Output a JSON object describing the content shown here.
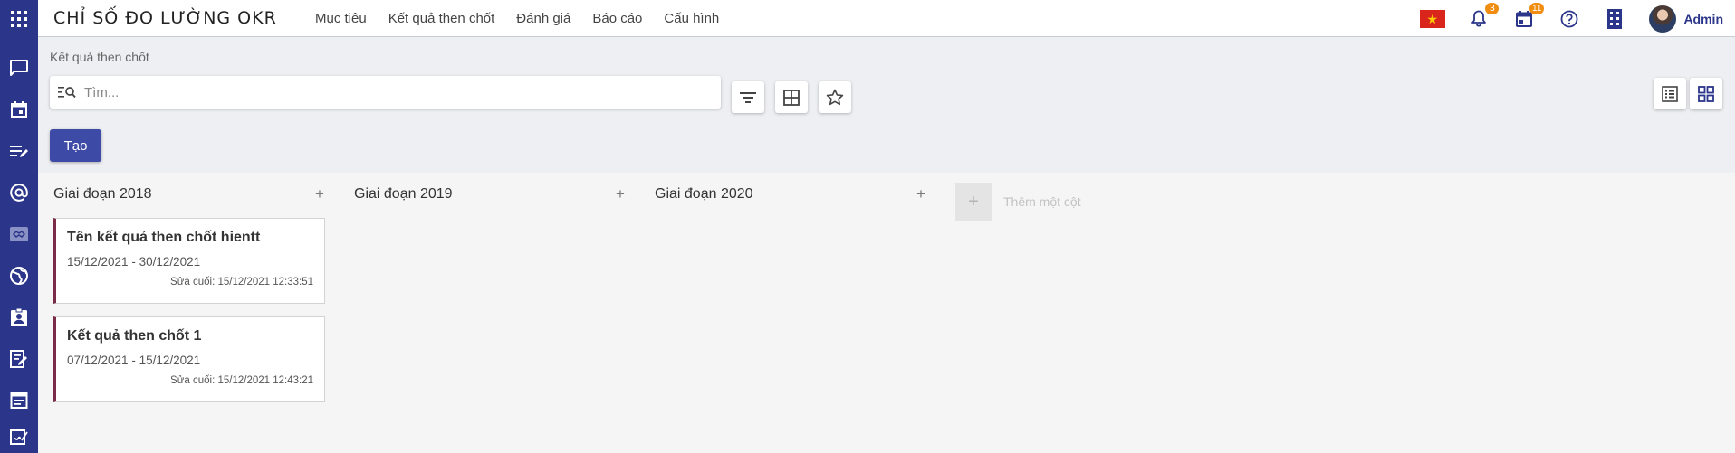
{
  "header": {
    "app_title": "CHỈ SỐ ĐO LƯỜNG OKR",
    "menu": [
      {
        "label": "Mục tiêu"
      },
      {
        "label": "Kết quả then chốt"
      },
      {
        "label": "Đánh giá"
      },
      {
        "label": "Báo cáo"
      },
      {
        "label": "Cấu hình"
      }
    ],
    "notifications_count": "3",
    "calendar_count": "11",
    "user_name": "Admin"
  },
  "sidebar": {
    "icons": [
      "chat-icon",
      "calendar-icon",
      "list-edit-icon",
      "at-sign-icon",
      "module-active-icon",
      "globe-icon",
      "contact-badge-icon",
      "note-edit-icon",
      "form-icon",
      "sign-document-icon"
    ]
  },
  "control_panel": {
    "breadcrumb": "Kết quả then chốt",
    "search_placeholder": "Tìm...",
    "create_label": "Tạo"
  },
  "kanban": {
    "columns": [
      {
        "title": "Giai đoạn 2018",
        "cards": [
          {
            "title": "Tên kết quả then chốt hientt",
            "dates": "15/12/2021 - 30/12/2021",
            "last_modified": "Sửa cuối: 15/12/2021 12:33:51"
          },
          {
            "title": "Kết quả then chốt 1",
            "dates": "07/12/2021 - 15/12/2021",
            "last_modified": "Sửa cuối: 15/12/2021 12:43:21"
          }
        ]
      },
      {
        "title": "Giai đoạn 2019",
        "cards": []
      },
      {
        "title": "Giai đoạn 2020",
        "cards": []
      }
    ],
    "add_column_label": "Thêm một cột"
  },
  "colors": {
    "primary": "#2b3589",
    "button": "#3d4aa6",
    "badge": "#f08c10",
    "card_accent": "#7a2b48"
  }
}
